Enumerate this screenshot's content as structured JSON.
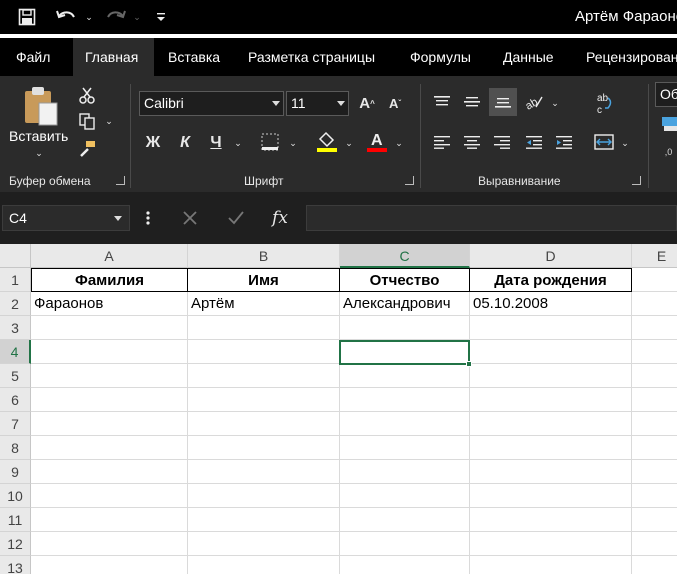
{
  "title_bar": {
    "title": "Артём Фараонов"
  },
  "menu": {
    "tabs": [
      "Файл",
      "Главная",
      "Вставка",
      "Разметка страницы",
      "Формулы",
      "Данные",
      "Рецензирование"
    ],
    "active": "Главная"
  },
  "ribbon": {
    "clipboard": {
      "paste_label": "Вставить",
      "group_label": "Буфер обмена"
    },
    "font": {
      "font_name": "Calibri",
      "font_size": "11",
      "bold_label": "Ж",
      "italic_label": "К",
      "underline_label": "Ч",
      "group_label": "Шрифт",
      "highlight_color": "#ffff00",
      "font_color": "#ff0000"
    },
    "alignment": {
      "group_label": "Выравнивание"
    },
    "number": {
      "format_value": "Об"
    }
  },
  "formula_bar": {
    "name_box": "C4",
    "fx_label": "fx",
    "content": ""
  },
  "sheet": {
    "columns": [
      "A",
      "B",
      "C",
      "D",
      "E"
    ],
    "selected_column": "C",
    "rows": [
      "1",
      "2",
      "3",
      "4",
      "5",
      "6",
      "7",
      "8",
      "9",
      "10",
      "11",
      "12",
      "13"
    ],
    "selected_row": "4",
    "header": [
      "Фамилия",
      "Имя",
      "Отчество",
      "Дата рождения"
    ],
    "record": [
      "Фараонов",
      "Артём",
      "Александрович",
      "05.10.2008"
    ],
    "active_cell": "C4",
    "accent_color": "#217346"
  }
}
